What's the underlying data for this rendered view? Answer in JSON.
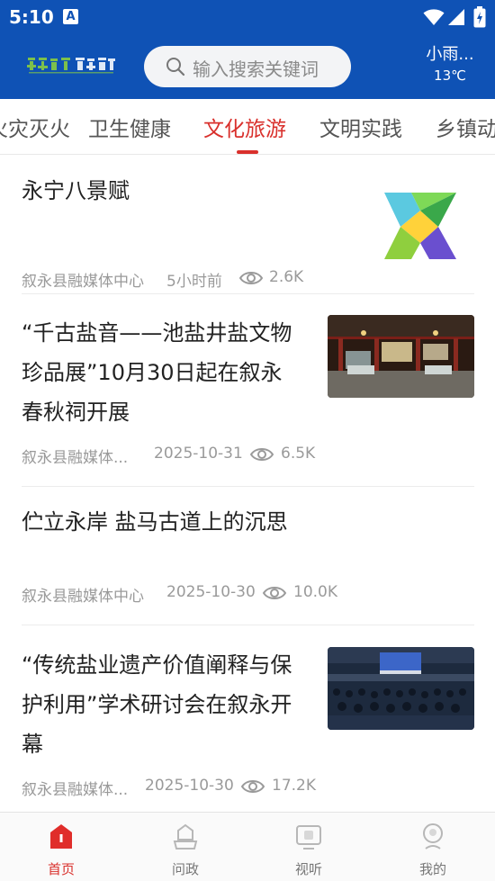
{
  "status_bar": {
    "time": "5:10",
    "notification_icon": "A"
  },
  "header": {
    "logo_text": "叙永融媒",
    "search": {
      "placeholder": "输入搜索关键词"
    },
    "weather": {
      "description": "小雨...",
      "temperature": "13℃"
    }
  },
  "tabs": [
    {
      "label": "火灾灭火"
    },
    {
      "label": "卫生健康"
    },
    {
      "label": "文化旅游",
      "active": true
    },
    {
      "label": "文明实践"
    },
    {
      "label": "乡镇动"
    }
  ],
  "articles": [
    {
      "title": "永宁八景赋",
      "source": "叙永县融媒体中心",
      "date": "5小时前",
      "views": "2.6K",
      "image": "x-logo-graphic"
    },
    {
      "title_lines": [
        "“千古盐音——池盐井盐文物",
        "珍品展”10月30日起在叙永",
        "春秋祠开展"
      ],
      "source": "叙永县融媒体...",
      "date": "2025-10-31",
      "views": "6.5K",
      "image": "exhibition-hall-photo"
    },
    {
      "title": "伫立永岸 盐马古道上的沉思",
      "source": "叙永县融媒体中心",
      "date": "2025-10-30",
      "views": "10.0K"
    },
    {
      "title_lines": [
        "“传统盐业遗产价值阐释与保",
        "护利用”学术研讨会在叙永开",
        "幕"
      ],
      "source": "叙永县融媒体...",
      "date": "2025-10-30",
      "views": "17.2K",
      "image": "conference-photo"
    }
  ],
  "bottom_nav": [
    {
      "label": "首页",
      "icon": "home-icon",
      "active": true
    },
    {
      "label": "问政",
      "icon": "ask-gov-icon"
    },
    {
      "label": "视听",
      "icon": "video-icon"
    },
    {
      "label": "我的",
      "icon": "profile-icon"
    }
  ],
  "colors": {
    "header_bg": "#0f52b5",
    "accent": "#d9302c",
    "text": "#222222",
    "meta": "#9a9a9a"
  }
}
